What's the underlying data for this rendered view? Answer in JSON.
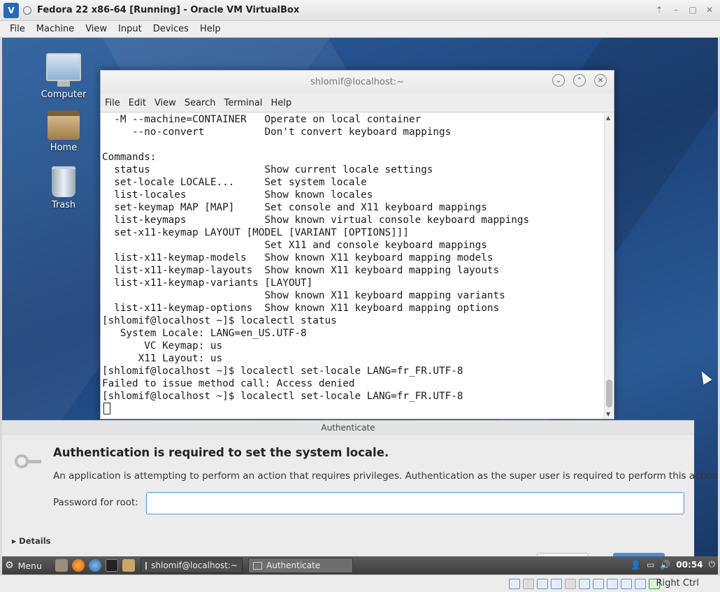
{
  "host": {
    "window_title": "Fedora 22 x86-64 [Running] - Oracle VM VirtualBox",
    "menus": [
      "File",
      "Machine",
      "View",
      "Input",
      "Devices",
      "Help"
    ],
    "host_key_label": "Right Ctrl"
  },
  "desktop": {
    "icons": [
      "Computer",
      "Home",
      "Trash"
    ]
  },
  "terminal": {
    "title": "shlomif@localhost:~",
    "menus": [
      "File",
      "Edit",
      "View",
      "Search",
      "Terminal",
      "Help"
    ],
    "lines": [
      "  -M --machine=CONTAINER   Operate on local container",
      "     --no-convert          Don't convert keyboard mappings",
      "",
      "Commands:",
      "  status                   Show current locale settings",
      "  set-locale LOCALE...     Set system locale",
      "  list-locales             Show known locales",
      "  set-keymap MAP [MAP]     Set console and X11 keyboard mappings",
      "  list-keymaps             Show known virtual console keyboard mappings",
      "  set-x11-keymap LAYOUT [MODEL [VARIANT [OPTIONS]]]",
      "                           Set X11 and console keyboard mappings",
      "  list-x11-keymap-models   Show known X11 keyboard mapping models",
      "  list-x11-keymap-layouts  Show known X11 keyboard mapping layouts",
      "  list-x11-keymap-variants [LAYOUT]",
      "                           Show known X11 keyboard mapping variants",
      "  list-x11-keymap-options  Show known X11 keyboard mapping options",
      "[shlomif@localhost ~]$ localectl status",
      "   System Locale: LANG=en_US.UTF-8",
      "       VC Keymap: us",
      "      X11 Layout: us",
      "[shlomif@localhost ~]$ localectl set-locale LANG=fr_FR.UTF-8",
      "Failed to issue method call: Access denied",
      "[shlomif@localhost ~]$ localectl set-locale LANG=fr_FR.UTF-8"
    ]
  },
  "auth": {
    "title": "Authenticate",
    "heading": "Authentication is required to set the system locale.",
    "message": "An application is attempting to perform an action that requires privileges. Authentication as the super user is required to perform this action.",
    "password_label": "Password for root:",
    "password_value": "",
    "details_label": "Details"
  },
  "panel": {
    "menu_label": "Menu",
    "tasks": [
      "shlomif@localhost:~",
      "Authenticate"
    ],
    "clock": "00:54"
  }
}
